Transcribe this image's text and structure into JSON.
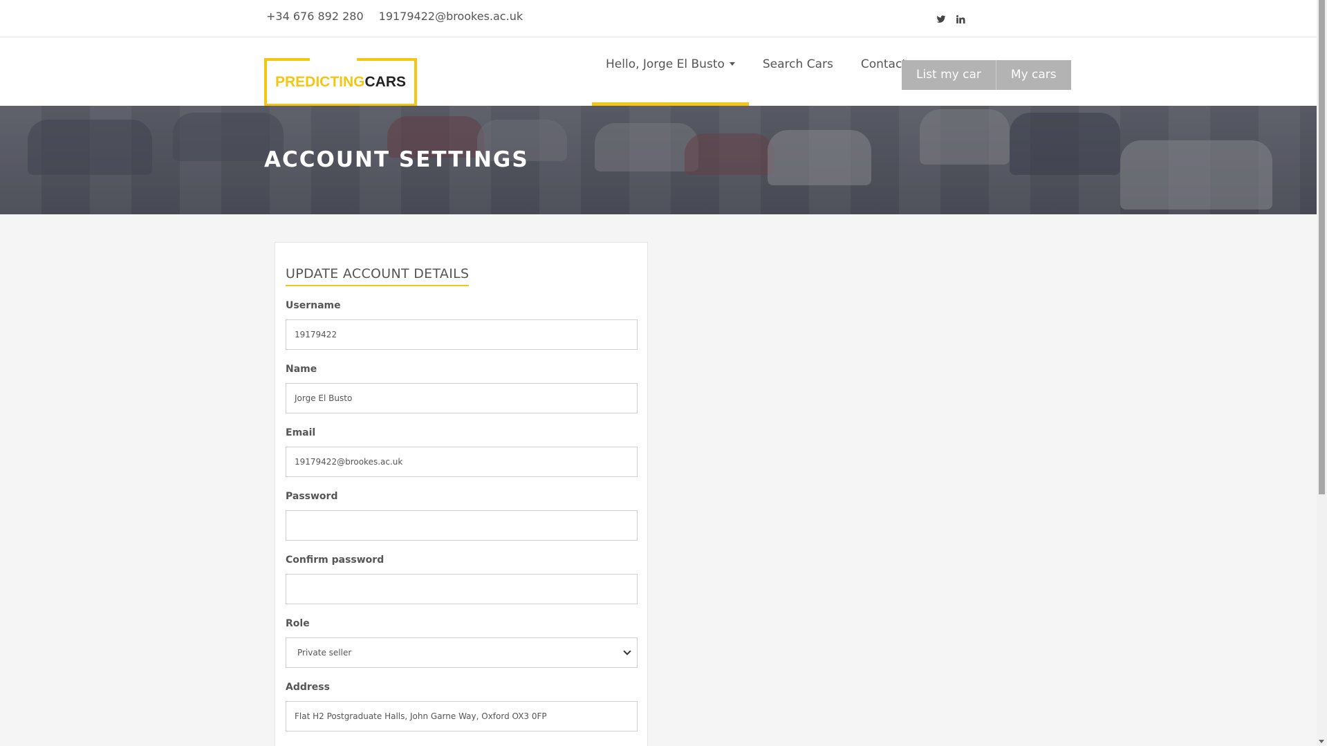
{
  "topbar": {
    "phone": "+34 676 892 280",
    "email": "19179422@brookes.ac.uk",
    "social": [
      "twitter-icon",
      "linkedin-icon"
    ]
  },
  "logo": {
    "part1": "PREDICTING",
    "part2": "CARS",
    "colors": {
      "accent": "#f3c614",
      "dark": "#222222"
    }
  },
  "nav": {
    "user_menu": "Hello, Jorge El Busto",
    "search": "Search Cars",
    "contact": "Contact",
    "list_my_car": "List my car",
    "my_cars": "My cars"
  },
  "hero": {
    "title": "ACCOUNT SETTINGS"
  },
  "form": {
    "title": "UPDATE ACCOUNT DETAILS",
    "username_label": "Username",
    "username_value": "19179422",
    "name_label": "Name",
    "name_value": "Jorge El Busto",
    "email_label": "Email",
    "email_value": "19179422@brookes.ac.uk",
    "password_label": "Password",
    "password_value": "",
    "confirm_label": "Confirm password",
    "confirm_value": "",
    "role_label": "Role",
    "role_value": "Private seller",
    "address_label": "Address",
    "address_value": "Flat H2 Postgraduate Halls, John Garne Way, Oxford OX3 0FP"
  }
}
